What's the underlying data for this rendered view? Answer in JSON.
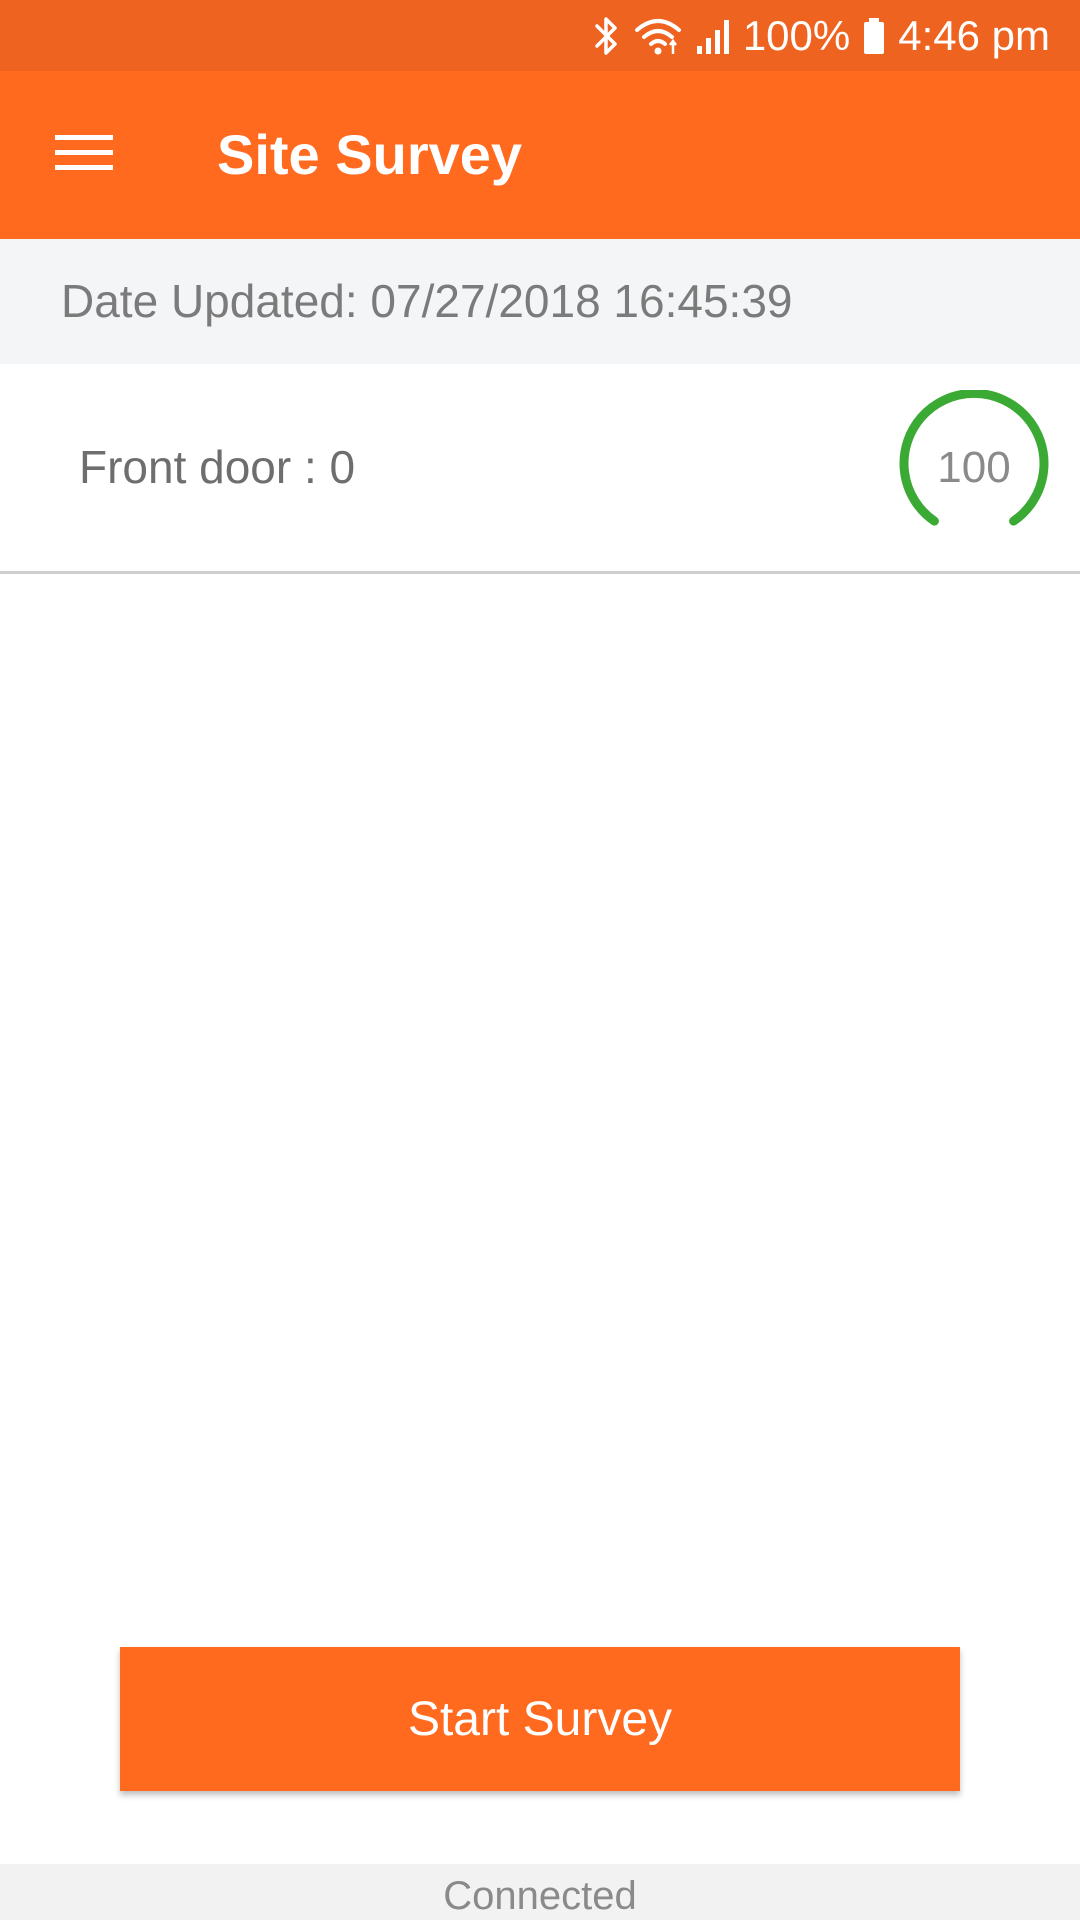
{
  "status_bar": {
    "battery_percent": "100%",
    "time": "4:46 pm",
    "icons": [
      "bluetooth-icon",
      "wifi-icon",
      "signal-icon",
      "battery-icon"
    ]
  },
  "app_bar": {
    "title": "Site Survey",
    "menu_icon": "hamburger-menu-icon"
  },
  "date_bar": {
    "text": "Date Updated: 07/27/2018 16:45:39"
  },
  "survey_items": [
    {
      "label": "Front door : 0",
      "gauge_value": "100",
      "gauge_color": "#3aaa35"
    }
  ],
  "start_button": {
    "label": "Start Survey"
  },
  "footer": {
    "status": "Connected"
  },
  "colors": {
    "status_bar": "#ee6320",
    "primary": "#ff6a1f",
    "gauge": "#3aaa35"
  }
}
